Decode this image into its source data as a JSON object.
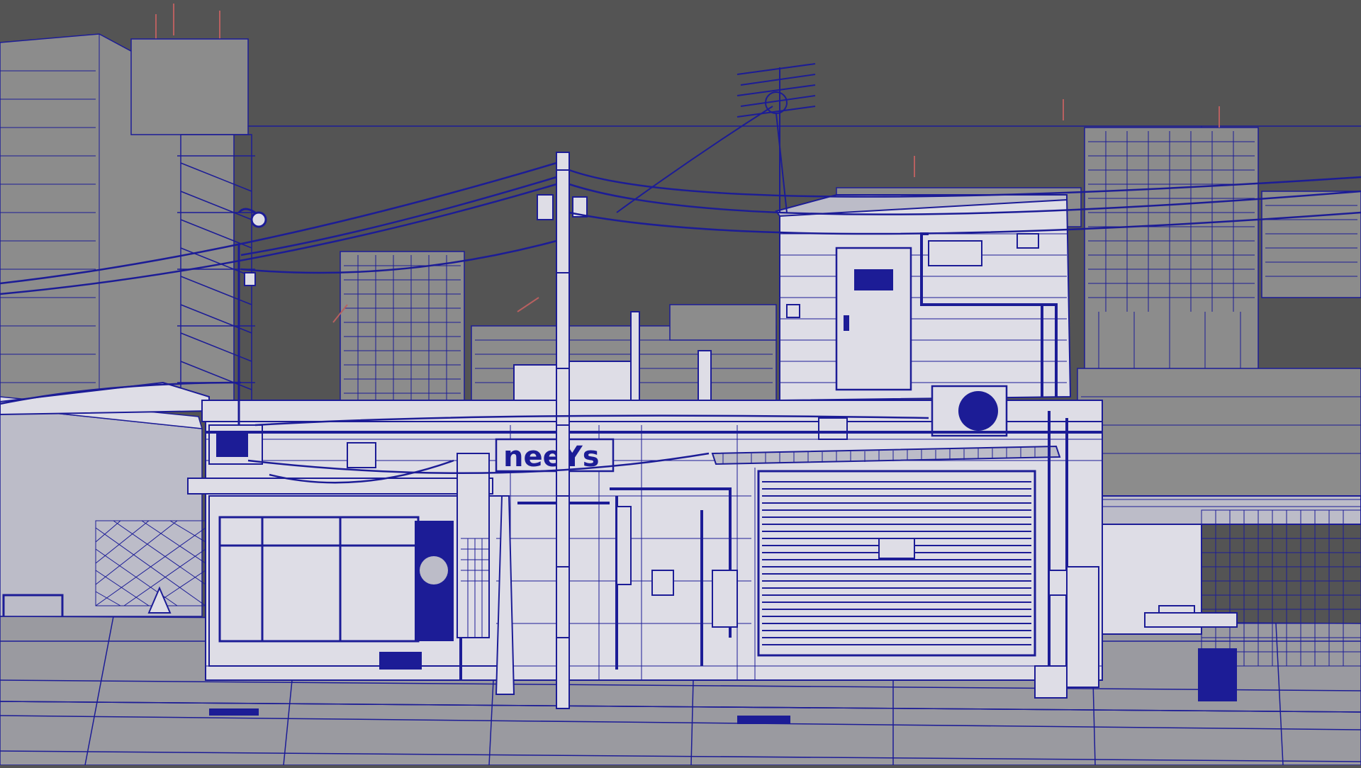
{
  "app": {
    "view": "wireframe-on-shaded"
  },
  "viewport": {
    "background_color": "#545454",
    "wire_color": "#1c1c96",
    "wire_light_color": "#2a2ab4",
    "shaded_color": "#dedde6",
    "shaded_dark_color": "#bcbcc8",
    "ground_color": "#9a9aa0",
    "distant_color": "#8c8c8c",
    "highlight_color": "#b86060"
  },
  "scene": {
    "shop_sign_text": "neeYs",
    "objects": [
      "left-highrise-tower",
      "fire-escape-stairs",
      "streetlight-pole",
      "utility-pole-center",
      "overhead-power-lines",
      "tv-antenna",
      "shop-building-front",
      "shop-window",
      "rolling-shutter-door",
      "rooftop-room",
      "rooftop-door",
      "ac-outdoor-unit",
      "corrugated-awning",
      "background-apartment-blocks",
      "sidewalk",
      "road-gutter",
      "chainlink-fence-left",
      "chainlink-fence-right",
      "trash-can",
      "plastic-crate",
      "water-tank",
      "electric-meters",
      "gas-meter"
    ]
  }
}
